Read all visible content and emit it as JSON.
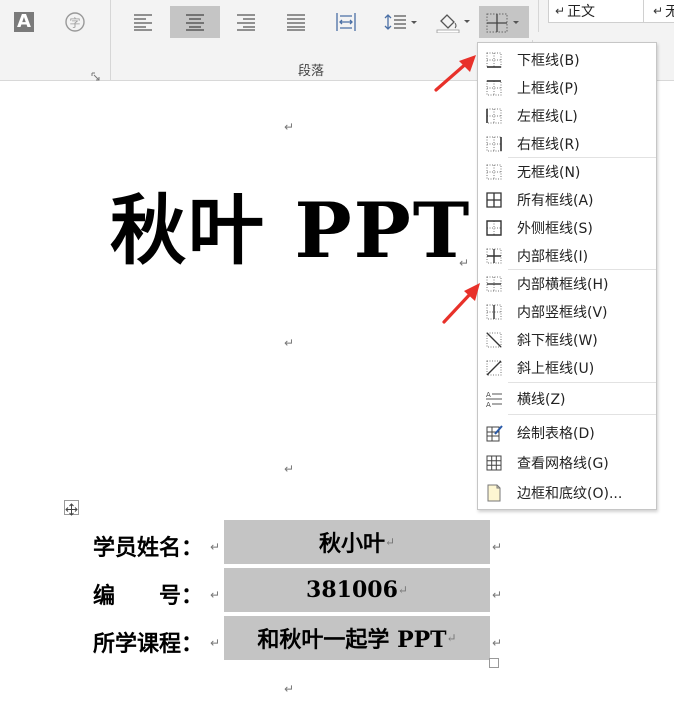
{
  "ribbon": {
    "group_label": "段落",
    "style_label": "正文",
    "style_partial": "无",
    "style_mark": "↵"
  },
  "menu": {
    "items": [
      {
        "label": "下框线(B)",
        "icon": "border-bottom-icon"
      },
      {
        "label": "上框线(P)",
        "icon": "border-top-icon"
      },
      {
        "label": "左框线(L)",
        "icon": "border-left-icon"
      },
      {
        "label": "右框线(R)",
        "icon": "border-right-icon"
      },
      {
        "label": "无框线(N)",
        "icon": "border-none-icon"
      },
      {
        "label": "所有框线(A)",
        "icon": "border-all-icon"
      },
      {
        "label": "外侧框线(S)",
        "icon": "border-outside-icon"
      },
      {
        "label": "内部框线(I)",
        "icon": "border-inside-icon"
      },
      {
        "label": "内部横框线(H)",
        "icon": "border-inside-horizontal-icon"
      },
      {
        "label": "内部竖框线(V)",
        "icon": "border-inside-vertical-icon"
      },
      {
        "label": "斜下框线(W)",
        "icon": "border-diagonal-down-icon"
      },
      {
        "label": "斜上框线(U)",
        "icon": "border-diagonal-up-icon"
      },
      {
        "label": "横线(Z)",
        "icon": "horizontal-line-icon"
      },
      {
        "label": "绘制表格(D)",
        "icon": "draw-table-icon"
      },
      {
        "label": "查看网格线(G)",
        "icon": "view-gridlines-icon"
      },
      {
        "label": "边框和底纹(O)...",
        "icon": "borders-shading-icon"
      }
    ]
  },
  "document": {
    "paragraph_mark": "↵",
    "title": "秋叶 PPT",
    "rows": [
      {
        "label": "学员姓名：",
        "value": "秋小叶"
      },
      {
        "label": "编　　号：",
        "value": "381006"
      },
      {
        "label": "所学课程：",
        "value": "和秋叶一起学 PPT"
      }
    ]
  },
  "colors": {
    "accent_arrow": "#e8312a",
    "cell_fill": "#c4c4c4",
    "selected_button": "#c5c5c5"
  }
}
